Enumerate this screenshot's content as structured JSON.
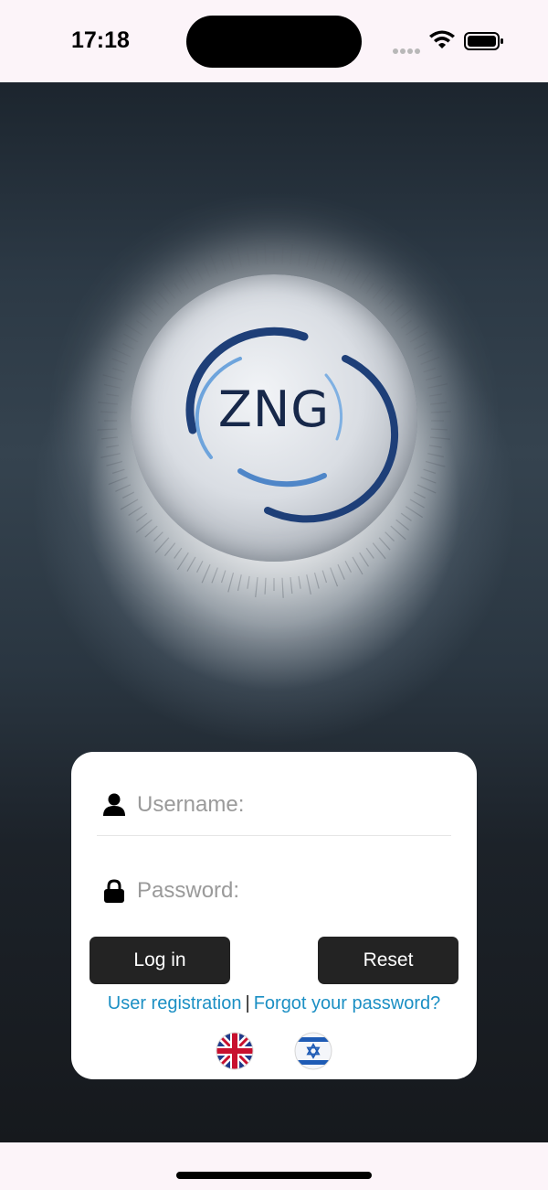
{
  "status_bar": {
    "time": "17:18",
    "icons": [
      "signal-dots-icon",
      "wifi-icon",
      "battery-icon"
    ]
  },
  "logo": {
    "text": "ZNG"
  },
  "login_form": {
    "username_placeholder": "Username:",
    "username_value": "",
    "password_placeholder": "Password:",
    "password_value": "",
    "login_label": "Log in",
    "reset_label": "Reset",
    "register_link": "User registration",
    "separator": "|",
    "forgot_link": "Forgot your password?",
    "languages": [
      {
        "icon": "uk-flag-icon"
      },
      {
        "icon": "israel-flag-icon"
      }
    ]
  },
  "colors": {
    "link": "#1b8fc4",
    "button_bg": "#232323",
    "logo_text": "#17284a",
    "logo_arc_dark": "#1e3f78",
    "logo_arc_light": "#5a8fd0"
  }
}
